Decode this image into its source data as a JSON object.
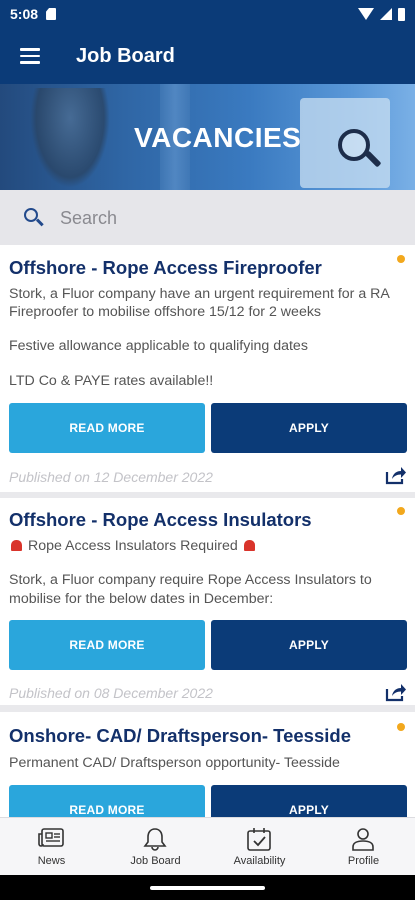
{
  "status_bar": {
    "time": "5:08"
  },
  "app_bar": {
    "title": "Job Board"
  },
  "banner": {
    "title": "VACANCIES"
  },
  "search": {
    "placeholder": "Search"
  },
  "jobs": [
    {
      "title": "Offshore - Rope Access Fireproofer",
      "lines": [
        "Stork, a Fluor company have an urgent requirement for a RA",
        "Fireproofer to mobilise offshore 15/12 for 2 weeks",
        "Festive allowance applicable to qualifying dates",
        "LTD Co & PAYE rates available!!"
      ],
      "read_more": "READ MORE",
      "apply": "APPLY",
      "published": "Published on 12 December 2022"
    },
    {
      "title": "Offshore - Rope Access Insulators",
      "lines": [
        "Rope Access Insulators Required",
        "Stork, a Fluor company require Rope Access Insulators to",
        "mobilise for the below dates in December:"
      ],
      "read_more": "READ MORE",
      "apply": "APPLY",
      "published": "Published on 08 December 2022"
    },
    {
      "title": "Onshore- CAD/ Draftsperson- Teesside",
      "lines": [
        "Permanent CAD/ Draftsperson opportunity- Teesside"
      ],
      "read_more": "READ MORE",
      "apply": "APPLY"
    }
  ],
  "bottom_nav": [
    {
      "label": "News",
      "icon": "newspaper-icon"
    },
    {
      "label": "Job Board",
      "icon": "bell-icon"
    },
    {
      "label": "Availability",
      "icon": "calendar-check-icon"
    },
    {
      "label": "Profile",
      "icon": "person-icon"
    }
  ],
  "colors": {
    "primary": "#0b3b78",
    "accent": "#2aa6dc",
    "unread_dot": "#f2a81d"
  }
}
